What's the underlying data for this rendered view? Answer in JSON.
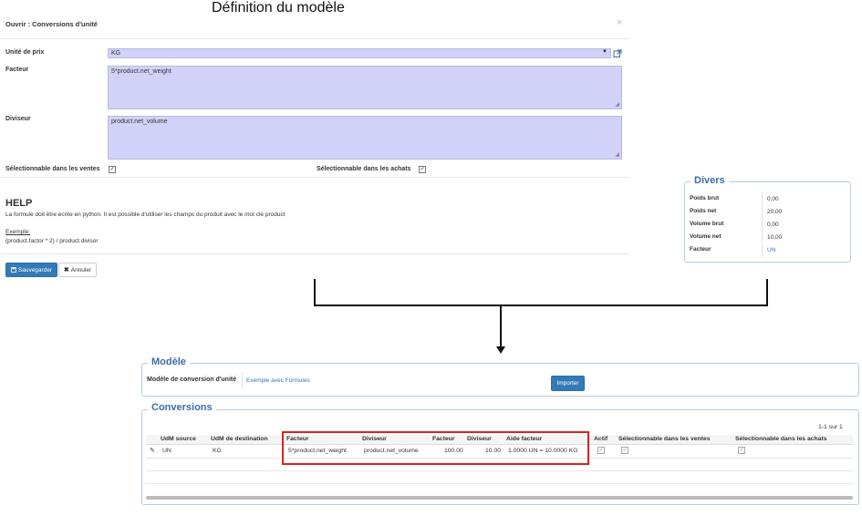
{
  "annotation_title": "Définition du modèle",
  "dialog": {
    "title": "Ouvrir : Conversions d'unité",
    "close_glyph": "×",
    "price_unit_label": "Unité de prix",
    "price_unit_value": "KG",
    "factor_label": "Facteur",
    "factor_value": "5*product.net_weight",
    "divisor_label": "Diviseur",
    "divisor_value": "product.net_volume",
    "sales_label": "Sélectionnable dans les ventes",
    "purchases_label": "Sélectionnable dans les achats",
    "help_title": "HELP",
    "help_text": "La formule doit être écrite en python. Il est possible d'utiliser les champs du produit avec le mot clé product",
    "example_label": "Exemple:",
    "example_text": "(product.factor * 2) / product.divisor",
    "save_label": "Sauvegarder",
    "cancel_label": "Annuler"
  },
  "divers": {
    "legend": "Divers",
    "rows": [
      {
        "label": "Poids brut",
        "value": "0,00"
      },
      {
        "label": "Poids net",
        "value": "20,00"
      },
      {
        "label": "Volume brut",
        "value": "0,00"
      },
      {
        "label": "Volume net",
        "value": "10,00"
      },
      {
        "label": "Facteur",
        "value": "UN"
      }
    ]
  },
  "modele": {
    "legend": "Modèle",
    "field_label": "Modèle de conversion d'unité",
    "field_value": "Exemple avec Formules",
    "import_label": "Importer"
  },
  "conversions": {
    "legend": "Conversions",
    "pager": "1-1 sur 1",
    "headers": [
      "UdM source",
      "UdM de destination",
      "Facteur",
      "Diviseur",
      "Facteur",
      "Diviseur",
      "Aide facteur",
      "Actif",
      "Sélectionnable dans les ventes",
      "Sélectionnable dans les achats"
    ],
    "row": {
      "source": "UN",
      "destination": "KG",
      "factor_formula": "5*product.net_weight",
      "divisor_formula": "product.net_volume",
      "factor": "100.00",
      "divisor": "10.00",
      "help": "1.0000 UN = 10.0000 KG"
    }
  },
  "colors": {
    "field_bg": "#d2d2f8",
    "primary": "#337ab7",
    "legend": "#3b6ea8",
    "highlight": "#e02020"
  }
}
